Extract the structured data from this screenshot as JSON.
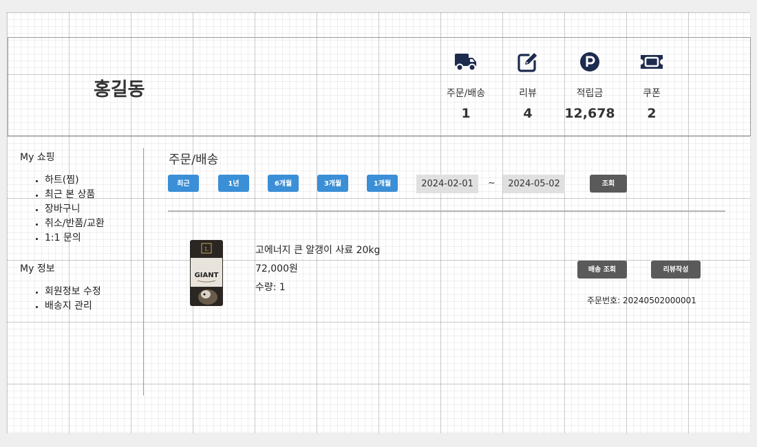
{
  "profile": {
    "name": "홍길동",
    "stats": [
      {
        "icon": "truck-icon",
        "label": "주문/배송",
        "value": "1"
      },
      {
        "icon": "edit-icon",
        "label": "리뷰",
        "value": "4"
      },
      {
        "icon": "point-icon",
        "label": "적립금",
        "value": "12,678"
      },
      {
        "icon": "ticket-icon",
        "label": "쿠폰",
        "value": "2"
      }
    ]
  },
  "sidebar": {
    "shopping_title": "My 쇼핑",
    "shopping_items": [
      "하트(찜)",
      "최근 본 상품",
      "장바구니",
      "취소/반품/교환",
      "1:1 문의"
    ],
    "info_title": "My 정보",
    "info_items": [
      "회원정보 수정",
      "배송지 관리"
    ]
  },
  "orders": {
    "title": "주문/배송",
    "periods": [
      "최근",
      "1년",
      "6개월",
      "3개월",
      "1개월"
    ],
    "date_from": "2024-02-01",
    "date_separator": "~",
    "date_to": "2024-05-02",
    "search_label": "조회"
  },
  "order_item": {
    "product_name": "고에너지 큰 알갱이 사료 20kg",
    "price": "72,000원",
    "quantity": "수량: 1",
    "image_text": "GIANT",
    "track_label": "배송 조회",
    "review_label": "리뷰작성",
    "order_number": "주문번호: 20240502000001"
  },
  "colors": {
    "accent": "#3a8fd6",
    "dark_button": "#5a5a5a",
    "icon": "#1d2b4f",
    "date_input_bg": "#e0e0e0"
  }
}
